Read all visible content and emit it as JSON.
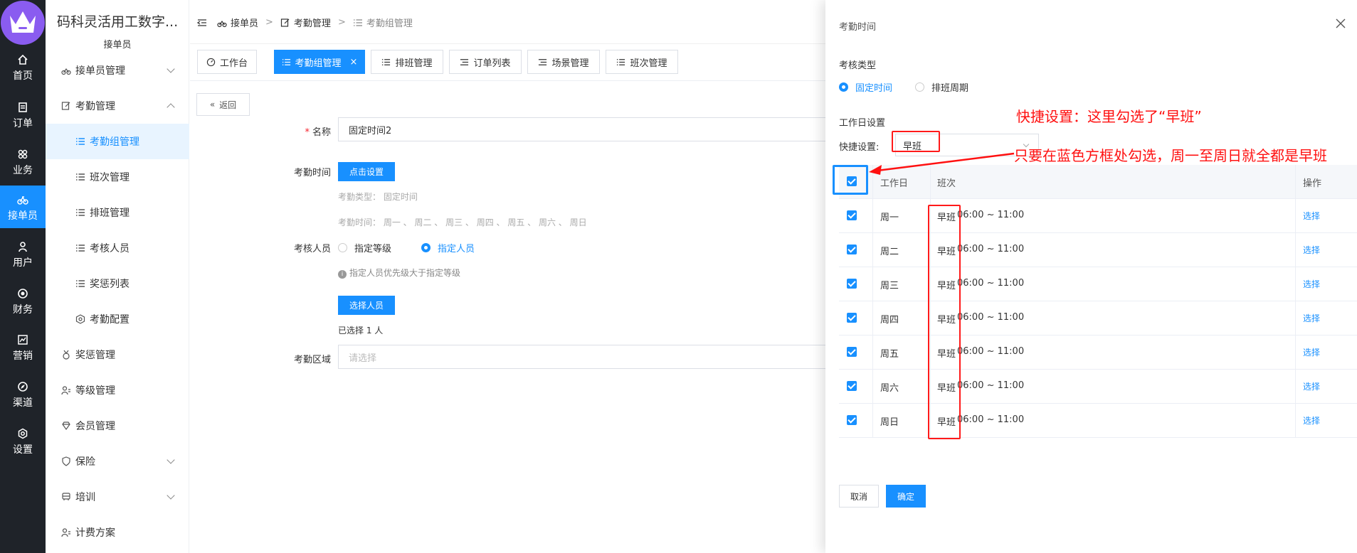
{
  "rail": {
    "items": [
      {
        "label": "首页",
        "icon": "home-icon"
      },
      {
        "label": "订单",
        "icon": "order-icon"
      },
      {
        "label": "业务",
        "icon": "business-icon"
      },
      {
        "label": "接单员",
        "icon": "rider-icon"
      },
      {
        "label": "用户",
        "icon": "user-icon"
      },
      {
        "label": "财务",
        "icon": "finance-icon"
      },
      {
        "label": "营销",
        "icon": "marketing-icon"
      },
      {
        "label": "渠道",
        "icon": "channel-icon"
      },
      {
        "label": "设置",
        "icon": "settings-icon"
      }
    ],
    "active_index": 3
  },
  "submenu": {
    "title": "码科灵活用工数字...",
    "subtitle": "接单员",
    "items": [
      {
        "label": "接单员管理",
        "icon": "bike-icon"
      },
      {
        "label": "考勤管理",
        "icon": "edit-icon"
      },
      {
        "label": "考勤组管理",
        "icon": "list-icon"
      },
      {
        "label": "班次管理",
        "icon": "list-icon"
      },
      {
        "label": "排班管理",
        "icon": "list-icon"
      },
      {
        "label": "考核人员",
        "icon": "list-icon"
      },
      {
        "label": "奖惩列表",
        "icon": "list-icon"
      },
      {
        "label": "考勤配置",
        "icon": "hexagon-icon"
      },
      {
        "label": "奖惩管理",
        "icon": "medal-icon"
      },
      {
        "label": "等级管理",
        "icon": "users-icon"
      },
      {
        "label": "会员管理",
        "icon": "gem-icon"
      },
      {
        "label": "保险",
        "icon": "shield-icon"
      },
      {
        "label": "培训",
        "icon": "bus-icon"
      },
      {
        "label": "计费方案",
        "icon": "users-icon"
      }
    ]
  },
  "breadcrumb": {
    "items": [
      "接单员",
      "考勤管理",
      "考勤组管理"
    ],
    "separator": ">"
  },
  "tabs": [
    {
      "label": "工作台"
    },
    {
      "label": "考勤组管理",
      "close": "×"
    },
    {
      "label": "排班管理"
    },
    {
      "label": "订单列表"
    },
    {
      "label": "场景管理"
    },
    {
      "label": "班次管理"
    }
  ],
  "form": {
    "back_label": "返回",
    "name_label": "名称",
    "name_value": "固定时间2",
    "time_label": "考勤时间",
    "set_button": "点击设置",
    "type_line": "考勤类型： 固定时间",
    "days_line": "考勤时间： 周一 、 周二 、 周三 、 周四 、 周五 、 周六 、 周日",
    "staff_label": "考核人员",
    "radio_level": "指定等级",
    "radio_person": "指定人员",
    "hint": "指定人员优先级大于指定等级",
    "select_staff_button": "选择人员",
    "selected_count": "已选择 1 人",
    "area_label": "考勤区域",
    "area_placeholder": "请选择"
  },
  "drawer": {
    "title": "考勤时间",
    "type_label": "考核类型",
    "type_fixed": "固定时间",
    "type_cycle": "排班周期",
    "workday_settings": "工作日设置",
    "quick_label": "快捷设置:",
    "quick_value": "早班",
    "columns": [
      "工作日",
      "班次",
      "操作"
    ],
    "rows": [
      {
        "day": "周一",
        "shift": "早班",
        "time": "06:00 ~ 11:00",
        "action": "选择"
      },
      {
        "day": "周二",
        "shift": "早班",
        "time": "06:00 ~ 11:00",
        "action": "选择"
      },
      {
        "day": "周三",
        "shift": "早班",
        "time": "06:00 ~ 11:00",
        "action": "选择"
      },
      {
        "day": "周四",
        "shift": "早班",
        "time": "06:00 ~ 11:00",
        "action": "选择"
      },
      {
        "day": "周五",
        "shift": "早班",
        "time": "06:00 ~ 11:00",
        "action": "选择"
      },
      {
        "day": "周六",
        "shift": "早班",
        "time": "06:00 ~ 11:00",
        "action": "选择"
      },
      {
        "day": "周日",
        "shift": "早班",
        "time": "06:00 ~ 11:00",
        "action": "选择"
      }
    ],
    "cancel": "取消",
    "confirm": "确定"
  },
  "annotations": {
    "note1": "快捷设置：这里勾选了“早班”",
    "note2": "只要在蓝色方框处勾选，周一至周日就全都是早班"
  },
  "colors": {
    "primary": "#1890ff",
    "rail_bg": "#1f2329",
    "annotation_red": "#ff1010",
    "logo_purple": "#8a5cf0"
  }
}
